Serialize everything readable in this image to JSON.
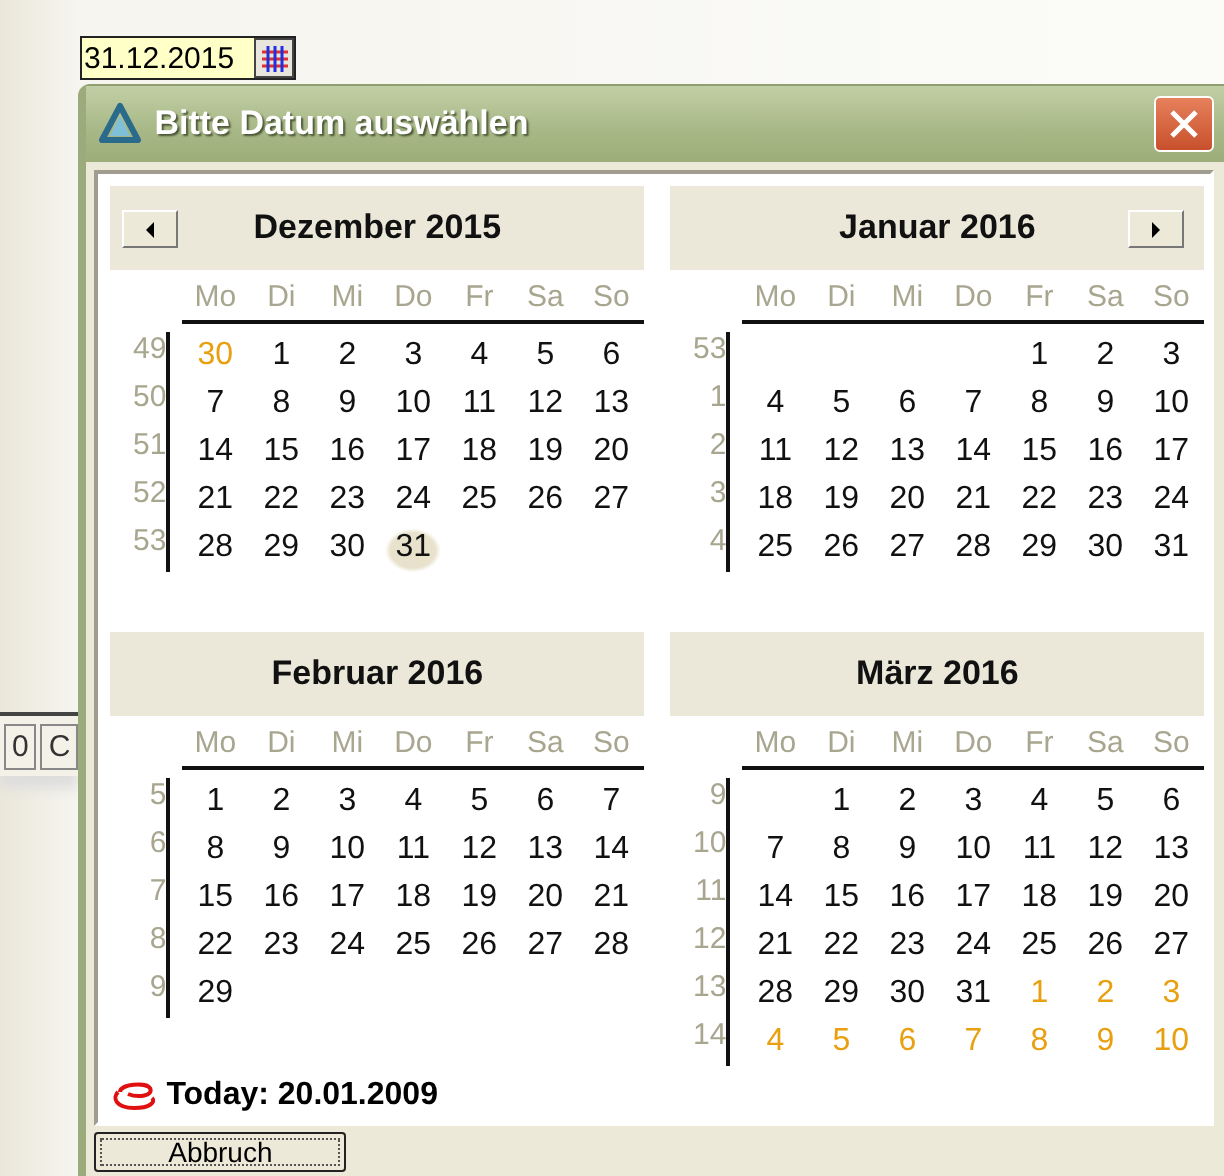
{
  "date_field": {
    "value": "31.12.2015"
  },
  "background": {
    "fragments": [
      "0",
      "C"
    ]
  },
  "dialog": {
    "title": "Bitte Datum auswählen",
    "months": [
      {
        "title": "Dezember 2015",
        "prev_button": true,
        "weekdays": [
          "Mo",
          "Di",
          "Mi",
          "Do",
          "Fr",
          "Sa",
          "So"
        ],
        "weeks": [
          {
            "number": "49",
            "days": [
              {
                "text": "30",
                "kind": "out",
                "selected": false
              },
              {
                "text": "1",
                "kind": "in",
                "selected": false
              },
              {
                "text": "2",
                "kind": "in",
                "selected": false
              },
              {
                "text": "3",
                "kind": "in",
                "selected": false
              },
              {
                "text": "4",
                "kind": "in",
                "selected": false
              },
              {
                "text": "5",
                "kind": "in",
                "selected": false
              },
              {
                "text": "6",
                "kind": "in",
                "selected": false
              }
            ]
          },
          {
            "number": "50",
            "days": [
              {
                "text": "7",
                "kind": "in",
                "selected": false
              },
              {
                "text": "8",
                "kind": "in",
                "selected": false
              },
              {
                "text": "9",
                "kind": "in",
                "selected": false
              },
              {
                "text": "10",
                "kind": "in",
                "selected": false
              },
              {
                "text": "11",
                "kind": "in",
                "selected": false
              },
              {
                "text": "12",
                "kind": "in",
                "selected": false
              },
              {
                "text": "13",
                "kind": "in",
                "selected": false
              }
            ]
          },
          {
            "number": "51",
            "days": [
              {
                "text": "14",
                "kind": "in",
                "selected": false
              },
              {
                "text": "15",
                "kind": "in",
                "selected": false
              },
              {
                "text": "16",
                "kind": "in",
                "selected": false
              },
              {
                "text": "17",
                "kind": "in",
                "selected": false
              },
              {
                "text": "18",
                "kind": "in",
                "selected": false
              },
              {
                "text": "19",
                "kind": "in",
                "selected": false
              },
              {
                "text": "20",
                "kind": "in",
                "selected": false
              }
            ]
          },
          {
            "number": "52",
            "days": [
              {
                "text": "21",
                "kind": "in",
                "selected": false
              },
              {
                "text": "22",
                "kind": "in",
                "selected": false
              },
              {
                "text": "23",
                "kind": "in",
                "selected": false
              },
              {
                "text": "24",
                "kind": "in",
                "selected": false
              },
              {
                "text": "25",
                "kind": "in",
                "selected": false
              },
              {
                "text": "26",
                "kind": "in",
                "selected": false
              },
              {
                "text": "27",
                "kind": "in",
                "selected": false
              }
            ]
          },
          {
            "number": "53",
            "days": [
              {
                "text": "28",
                "kind": "in",
                "selected": false
              },
              {
                "text": "29",
                "kind": "in",
                "selected": false
              },
              {
                "text": "30",
                "kind": "in",
                "selected": false
              },
              {
                "text": "31",
                "kind": "in",
                "selected": true
              },
              {
                "kind": "blank"
              },
              {
                "kind": "blank"
              },
              {
                "kind": "blank"
              }
            ]
          }
        ]
      },
      {
        "title": "Januar 2016",
        "next_button": true,
        "weekdays": [
          "Mo",
          "Di",
          "Mi",
          "Do",
          "Fr",
          "Sa",
          "So"
        ],
        "weeks": [
          {
            "number": "53",
            "days": [
              {
                "kind": "blank"
              },
              {
                "kind": "blank"
              },
              {
                "kind": "blank"
              },
              {
                "kind": "blank"
              },
              {
                "text": "1",
                "kind": "in",
                "selected": false
              },
              {
                "text": "2",
                "kind": "in",
                "selected": false
              },
              {
                "text": "3",
                "kind": "in",
                "selected": false
              }
            ]
          },
          {
            "number": "1",
            "days": [
              {
                "text": "4",
                "kind": "in",
                "selected": false
              },
              {
                "text": "5",
                "kind": "in",
                "selected": false
              },
              {
                "text": "6",
                "kind": "in",
                "selected": false
              },
              {
                "text": "7",
                "kind": "in",
                "selected": false
              },
              {
                "text": "8",
                "kind": "in",
                "selected": false
              },
              {
                "text": "9",
                "kind": "in",
                "selected": false
              },
              {
                "text": "10",
                "kind": "in",
                "selected": false
              }
            ]
          },
          {
            "number": "2",
            "days": [
              {
                "text": "11",
                "kind": "in",
                "selected": false
              },
              {
                "text": "12",
                "kind": "in",
                "selected": false
              },
              {
                "text": "13",
                "kind": "in",
                "selected": false
              },
              {
                "text": "14",
                "kind": "in",
                "selected": false
              },
              {
                "text": "15",
                "kind": "in",
                "selected": false
              },
              {
                "text": "16",
                "kind": "in",
                "selected": false
              },
              {
                "text": "17",
                "kind": "in",
                "selected": false
              }
            ]
          },
          {
            "number": "3",
            "days": [
              {
                "text": "18",
                "kind": "in",
                "selected": false
              },
              {
                "text": "19",
                "kind": "in",
                "selected": false
              },
              {
                "text": "20",
                "kind": "in",
                "selected": false
              },
              {
                "text": "21",
                "kind": "in",
                "selected": false
              },
              {
                "text": "22",
                "kind": "in",
                "selected": false
              },
              {
                "text": "23",
                "kind": "in",
                "selected": false
              },
              {
                "text": "24",
                "kind": "in",
                "selected": false
              }
            ]
          },
          {
            "number": "4",
            "days": [
              {
                "text": "25",
                "kind": "in",
                "selected": false
              },
              {
                "text": "26",
                "kind": "in",
                "selected": false
              },
              {
                "text": "27",
                "kind": "in",
                "selected": false
              },
              {
                "text": "28",
                "kind": "in",
                "selected": false
              },
              {
                "text": "29",
                "kind": "in",
                "selected": false
              },
              {
                "text": "30",
                "kind": "in",
                "selected": false
              },
              {
                "text": "31",
                "kind": "in",
                "selected": false
              }
            ]
          }
        ]
      },
      {
        "title": "Februar 2016",
        "weekdays": [
          "Mo",
          "Di",
          "Mi",
          "Do",
          "Fr",
          "Sa",
          "So"
        ],
        "weeks": [
          {
            "number": "5",
            "days": [
              {
                "text": "1",
                "kind": "in",
                "selected": false
              },
              {
                "text": "2",
                "kind": "in",
                "selected": false
              },
              {
                "text": "3",
                "kind": "in",
                "selected": false
              },
              {
                "text": "4",
                "kind": "in",
                "selected": false
              },
              {
                "text": "5",
                "kind": "in",
                "selected": false
              },
              {
                "text": "6",
                "kind": "in",
                "selected": false
              },
              {
                "text": "7",
                "kind": "in",
                "selected": false
              }
            ]
          },
          {
            "number": "6",
            "days": [
              {
                "text": "8",
                "kind": "in",
                "selected": false
              },
              {
                "text": "9",
                "kind": "in",
                "selected": false
              },
              {
                "text": "10",
                "kind": "in",
                "selected": false
              },
              {
                "text": "11",
                "kind": "in",
                "selected": false
              },
              {
                "text": "12",
                "kind": "in",
                "selected": false
              },
              {
                "text": "13",
                "kind": "in",
                "selected": false
              },
              {
                "text": "14",
                "kind": "in",
                "selected": false
              }
            ]
          },
          {
            "number": "7",
            "days": [
              {
                "text": "15",
                "kind": "in",
                "selected": false
              },
              {
                "text": "16",
                "kind": "in",
                "selected": false
              },
              {
                "text": "17",
                "kind": "in",
                "selected": false
              },
              {
                "text": "18",
                "kind": "in",
                "selected": false
              },
              {
                "text": "19",
                "kind": "in",
                "selected": false
              },
              {
                "text": "20",
                "kind": "in",
                "selected": false
              },
              {
                "text": "21",
                "kind": "in",
                "selected": false
              }
            ]
          },
          {
            "number": "8",
            "days": [
              {
                "text": "22",
                "kind": "in",
                "selected": false
              },
              {
                "text": "23",
                "kind": "in",
                "selected": false
              },
              {
                "text": "24",
                "kind": "in",
                "selected": false
              },
              {
                "text": "25",
                "kind": "in",
                "selected": false
              },
              {
                "text": "26",
                "kind": "in",
                "selected": false
              },
              {
                "text": "27",
                "kind": "in",
                "selected": false
              },
              {
                "text": "28",
                "kind": "in",
                "selected": false
              }
            ]
          },
          {
            "number": "9",
            "days": [
              {
                "text": "29",
                "kind": "in",
                "selected": false
              },
              {
                "kind": "blank"
              },
              {
                "kind": "blank"
              },
              {
                "kind": "blank"
              },
              {
                "kind": "blank"
              },
              {
                "kind": "blank"
              },
              {
                "kind": "blank"
              }
            ]
          }
        ]
      },
      {
        "title": "März 2016",
        "weekdays": [
          "Mo",
          "Di",
          "Mi",
          "Do",
          "Fr",
          "Sa",
          "So"
        ],
        "weeks": [
          {
            "number": "9",
            "days": [
              {
                "kind": "blank"
              },
              {
                "text": "1",
                "kind": "in",
                "selected": false
              },
              {
                "text": "2",
                "kind": "in",
                "selected": false
              },
              {
                "text": "3",
                "kind": "in",
                "selected": false
              },
              {
                "text": "4",
                "kind": "in",
                "selected": false
              },
              {
                "text": "5",
                "kind": "in",
                "selected": false
              },
              {
                "text": "6",
                "kind": "in",
                "selected": false
              }
            ]
          },
          {
            "number": "10",
            "days": [
              {
                "text": "7",
                "kind": "in",
                "selected": false
              },
              {
                "text": "8",
                "kind": "in",
                "selected": false
              },
              {
                "text": "9",
                "kind": "in",
                "selected": false
              },
              {
                "text": "10",
                "kind": "in",
                "selected": false
              },
              {
                "text": "11",
                "kind": "in",
                "selected": false
              },
              {
                "text": "12",
                "kind": "in",
                "selected": false
              },
              {
                "text": "13",
                "kind": "in",
                "selected": false
              }
            ]
          },
          {
            "number": "11",
            "days": [
              {
                "text": "14",
                "kind": "in",
                "selected": false
              },
              {
                "text": "15",
                "kind": "in",
                "selected": false
              },
              {
                "text": "16",
                "kind": "in",
                "selected": false
              },
              {
                "text": "17",
                "kind": "in",
                "selected": false
              },
              {
                "text": "18",
                "kind": "in",
                "selected": false
              },
              {
                "text": "19",
                "kind": "in",
                "selected": false
              },
              {
                "text": "20",
                "kind": "in",
                "selected": false
              }
            ]
          },
          {
            "number": "12",
            "days": [
              {
                "text": "21",
                "kind": "in",
                "selected": false
              },
              {
                "text": "22",
                "kind": "in",
                "selected": false
              },
              {
                "text": "23",
                "kind": "in",
                "selected": false
              },
              {
                "text": "24",
                "kind": "in",
                "selected": false
              },
              {
                "text": "25",
                "kind": "in",
                "selected": false
              },
              {
                "text": "26",
                "kind": "in",
                "selected": false
              },
              {
                "text": "27",
                "kind": "in",
                "selected": false
              }
            ]
          },
          {
            "number": "13",
            "days": [
              {
                "text": "28",
                "kind": "in",
                "selected": false
              },
              {
                "text": "29",
                "kind": "in",
                "selected": false
              },
              {
                "text": "30",
                "kind": "in",
                "selected": false
              },
              {
                "text": "31",
                "kind": "in",
                "selected": false
              },
              {
                "text": "1",
                "kind": "out",
                "selected": false
              },
              {
                "text": "2",
                "kind": "out",
                "selected": false
              },
              {
                "text": "3",
                "kind": "out",
                "selected": false
              }
            ]
          },
          {
            "number": "14",
            "days": [
              {
                "text": "4",
                "kind": "out",
                "selected": false
              },
              {
                "text": "5",
                "kind": "out",
                "selected": false
              },
              {
                "text": "6",
                "kind": "out",
                "selected": false
              },
              {
                "text": "7",
                "kind": "out",
                "selected": false
              },
              {
                "text": "8",
                "kind": "out",
                "selected": false
              },
              {
                "text": "9",
                "kind": "out",
                "selected": false
              },
              {
                "text": "10",
                "kind": "out",
                "selected": false
              }
            ]
          }
        ]
      }
    ],
    "today": "Today: 20.01.2009",
    "cancel_button": "Abbruch"
  }
}
